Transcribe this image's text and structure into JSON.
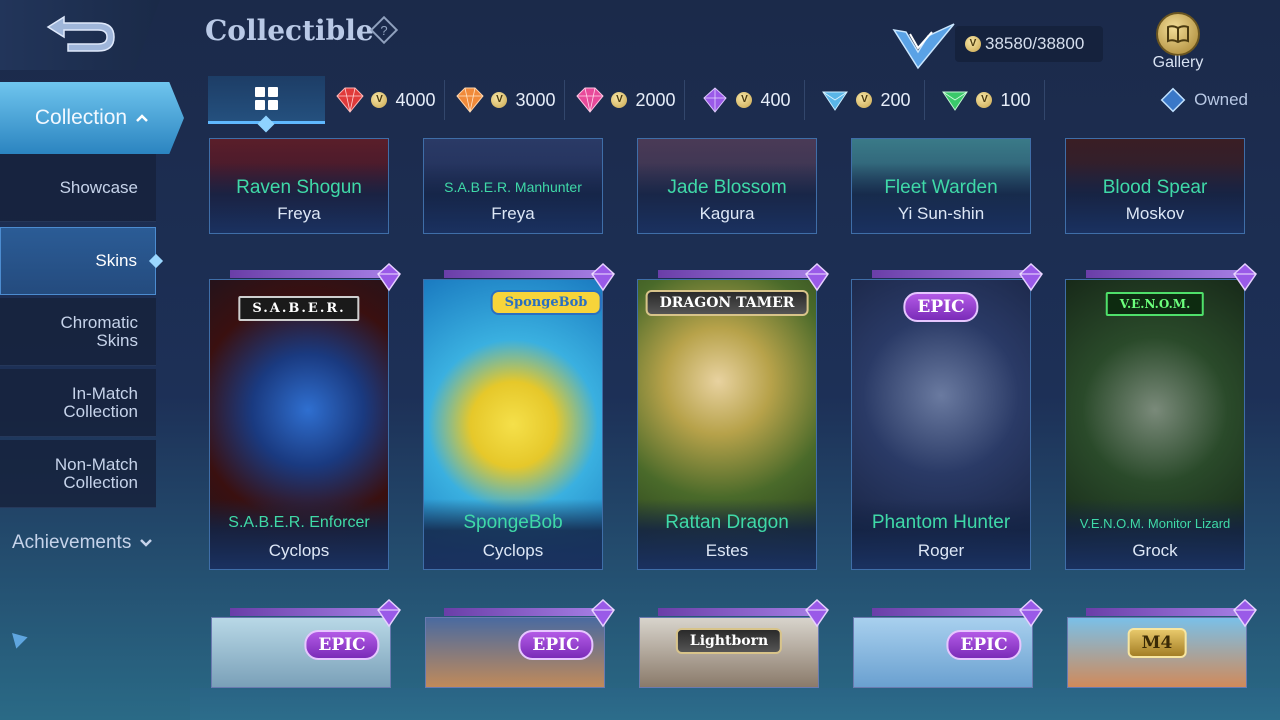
{
  "header": {
    "title": "Collectible",
    "points": "38580/38800",
    "gallery_label": "Gallery"
  },
  "tabs": [
    {
      "gem": "red-gem",
      "color": "#e03a3a",
      "value": "4000"
    },
    {
      "gem": "orange-gem",
      "color": "#f08a3a",
      "value": "3000"
    },
    {
      "gem": "pink-gem",
      "color": "#e84a9a",
      "value": "2000"
    },
    {
      "gem": "purple-gem",
      "color": "#9a5ae8",
      "value": "400"
    },
    {
      "gem": "blue-gem",
      "color": "#5ab6e8",
      "value": "200"
    },
    {
      "gem": "green-gem",
      "color": "#3ac86a",
      "value": "100"
    }
  ],
  "owned_label": "Owned",
  "sidebar": {
    "collection": "Collection",
    "items": [
      {
        "label": "Showcase"
      },
      {
        "label": "Skins"
      },
      {
        "label_line1": "Chromatic",
        "label_line2": "Skins"
      },
      {
        "label_line1": "In-Match",
        "label_line2": "Collection"
      },
      {
        "label_line1": "Non-Match",
        "label_line2": "Collection"
      }
    ],
    "achievements": "Achievements"
  },
  "rows": [
    [
      {
        "skin": "Raven Shogun",
        "hero": "Freya"
      },
      {
        "skin": "S.A.B.E.R. Manhunter",
        "hero": "Freya"
      },
      {
        "skin": "Jade Blossom",
        "hero": "Kagura"
      },
      {
        "skin": "Fleet Warden",
        "hero": "Yi Sun-shin"
      },
      {
        "skin": "Blood Spear",
        "hero": "Moskov"
      }
    ],
    [
      {
        "skin": "S.A.B.E.R. Enforcer",
        "hero": "Cyclops",
        "badge": "S.A.B.E.R."
      },
      {
        "skin": "SpongeBob",
        "hero": "Cyclops",
        "badge": "SpongeBob"
      },
      {
        "skin": "Rattan Dragon",
        "hero": "Estes",
        "badge": "DRAGON TAMER"
      },
      {
        "skin": "Phantom Hunter",
        "hero": "Roger",
        "badge": "EPIC"
      },
      {
        "skin": "V.E.N.O.M. Monitor Lizard",
        "hero": "Grock",
        "badge": "V.E.N.O.M."
      }
    ],
    [
      {
        "badge": "EPIC"
      },
      {
        "badge": "EPIC"
      },
      {
        "badge": "Lightborn"
      },
      {
        "badge": "EPIC"
      },
      {
        "badge": "M4"
      }
    ]
  ]
}
